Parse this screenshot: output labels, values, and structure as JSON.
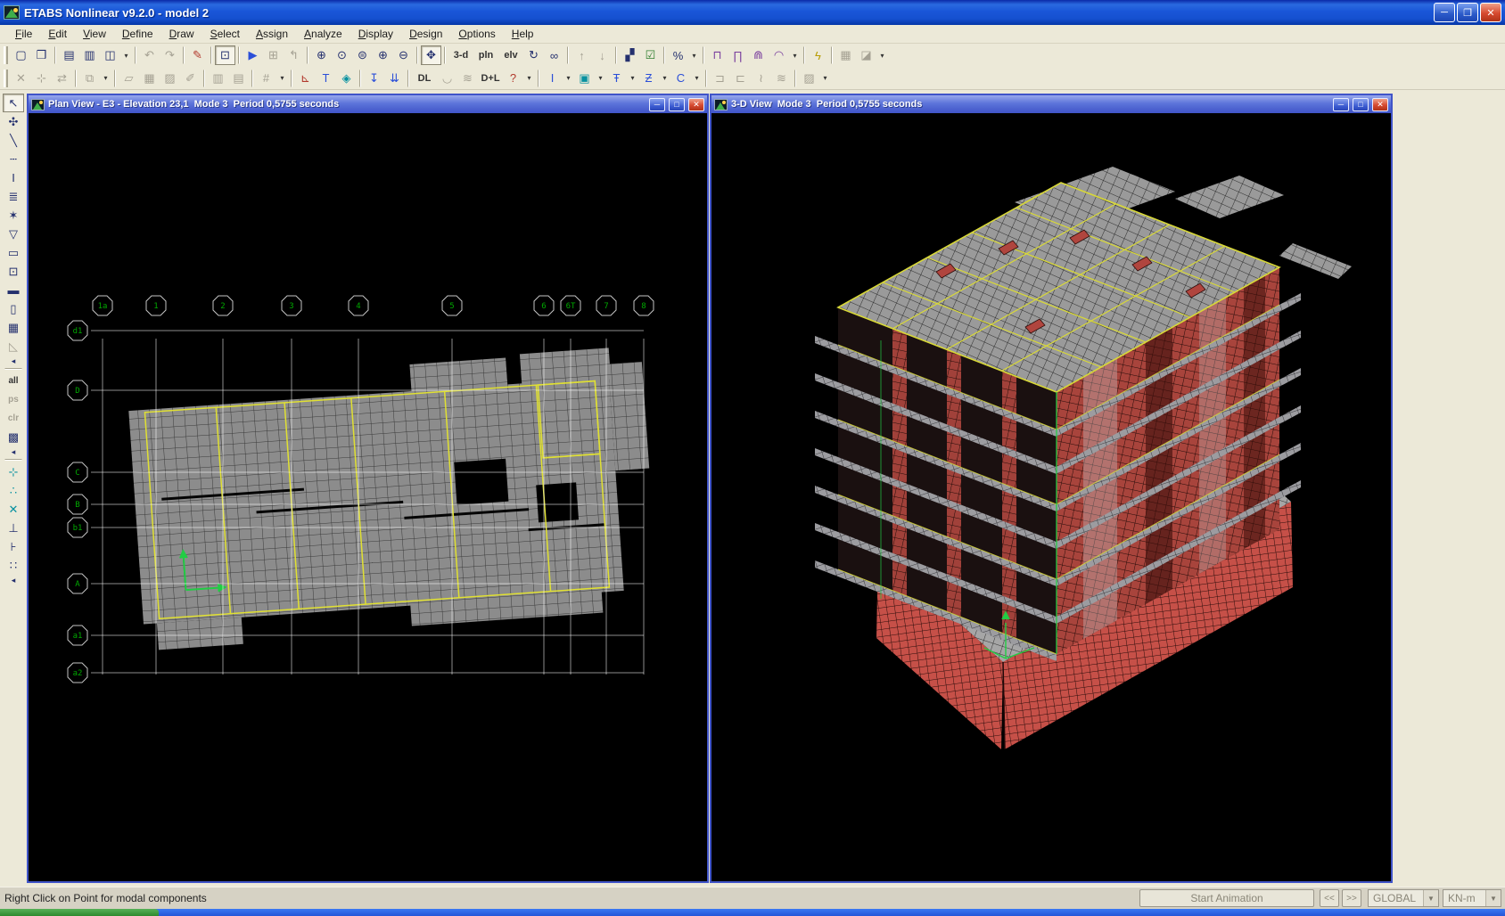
{
  "app": {
    "title": "ETABS Nonlinear v9.2.0 - model 2",
    "controls": [
      {
        "name": "app-minimize-button",
        "glyph": "─"
      },
      {
        "name": "app-restore-button",
        "glyph": "❐"
      },
      {
        "name": "app-close-button",
        "glyph": "✕",
        "cls": "close"
      }
    ]
  },
  "menu": {
    "items": [
      "File",
      "Edit",
      "View",
      "Define",
      "Draw",
      "Select",
      "Assign",
      "Analyze",
      "Display",
      "Design",
      "Options",
      "Help"
    ]
  },
  "toolbar_main": {
    "items": [
      {
        "name": "new-model-button",
        "glyph": "▢"
      },
      {
        "name": "open-file-button",
        "glyph": "❒"
      },
      {
        "name": "separator",
        "cls": "tsep"
      },
      {
        "name": "save-model-button",
        "glyph": "▤"
      },
      {
        "name": "print-button",
        "glyph": "▥"
      },
      {
        "name": "print-graphics-button",
        "glyph": "◫"
      },
      {
        "name": "print-options-caret",
        "glyph": "▾",
        "cls": "caret"
      },
      {
        "name": "separator",
        "cls": "tsep"
      },
      {
        "name": "undo-button",
        "glyph": "↶",
        "cls": "disabled"
      },
      {
        "name": "redo-button",
        "glyph": "↷",
        "cls": "disabled"
      },
      {
        "name": "separator",
        "cls": "tsep"
      },
      {
        "name": "edit-model-button",
        "glyph": "✎",
        "cls": "c-red"
      },
      {
        "name": "separator",
        "cls": "tsep"
      },
      {
        "name": "lock-model-button",
        "glyph": "⊡",
        "cls": "pressed"
      },
      {
        "name": "separator",
        "cls": "tsep"
      },
      {
        "name": "run-analysis-button",
        "glyph": "▶",
        "cls": "c-blue"
      },
      {
        "name": "run-construction-sequence-button",
        "glyph": "⊞",
        "cls": "disabled"
      },
      {
        "name": "restore-previous-button",
        "glyph": "↰",
        "cls": "disabled"
      },
      {
        "name": "separator",
        "cls": "tsep"
      },
      {
        "name": "rubber-band-zoom-button",
        "glyph": "⊕"
      },
      {
        "name": "restore-full-view-button",
        "glyph": "⊙"
      },
      {
        "name": "previous-zoom-button",
        "glyph": "⊜"
      },
      {
        "name": "zoom-in-button",
        "glyph": "⊕"
      },
      {
        "name": "zoom-out-button",
        "glyph": "⊖"
      },
      {
        "name": "separator",
        "cls": "tsep"
      },
      {
        "name": "pan-button",
        "glyph": "✥",
        "cls": "pressed"
      },
      {
        "name": "separator",
        "cls": "tsep"
      },
      {
        "name": "view-3d-button",
        "glyph": "3-d",
        "cls": "txt"
      },
      {
        "name": "view-plan-button",
        "glyph": "pln",
        "cls": "txt"
      },
      {
        "name": "view-elevation-button",
        "glyph": "elv",
        "cls": "txt"
      },
      {
        "name": "rotate-3d-view-button",
        "glyph": "↻"
      },
      {
        "name": "perspective-toggle-button",
        "glyph": "∞"
      },
      {
        "name": "separator",
        "cls": "tsep"
      },
      {
        "name": "move-up-in-list-button",
        "glyph": "↑",
        "cls": "disabled"
      },
      {
        "name": "move-down-in-list-button",
        "glyph": "↓",
        "cls": "disabled"
      },
      {
        "name": "separator",
        "cls": "tsep"
      },
      {
        "name": "object-shrink-toggle-button",
        "glyph": "▞"
      },
      {
        "name": "set-view-options-button",
        "glyph": "☑",
        "cls": "c-green"
      },
      {
        "name": "separator",
        "cls": "tsep"
      },
      {
        "name": "assign-display-button",
        "glyph": "%"
      },
      {
        "name": "assign-display-caret",
        "glyph": "▾",
        "cls": "caret"
      },
      {
        "name": "separator",
        "cls": "tsep"
      },
      {
        "name": "quick-draw-portal-button",
        "glyph": "⊓",
        "cls": "c-purple"
      },
      {
        "name": "quick-draw-frame-button",
        "glyph": "∏",
        "cls": "c-purple"
      },
      {
        "name": "quick-draw-braced-button",
        "glyph": "⋒",
        "cls": "c-purple"
      },
      {
        "name": "quick-draw-truss-button",
        "glyph": "◠",
        "cls": "c-purple"
      },
      {
        "name": "quick-draw-caret",
        "glyph": "▾",
        "cls": "caret"
      },
      {
        "name": "separator",
        "cls": "tsep"
      },
      {
        "name": "run-button",
        "glyph": "ϟ",
        "cls": "c-yellow"
      },
      {
        "name": "separator",
        "cls": "tsep"
      },
      {
        "name": "design-concrete-button",
        "glyph": "▦",
        "cls": "disabled"
      },
      {
        "name": "design-steel-button",
        "glyph": "◪",
        "cls": "disabled"
      },
      {
        "name": "design-caret",
        "glyph": "▾",
        "cls": "caret"
      }
    ]
  },
  "toolbar_second": {
    "items": [
      {
        "name": "delete-button",
        "glyph": "✕",
        "cls": "disabled"
      },
      {
        "name": "move-points-button",
        "glyph": "⊹",
        "cls": "disabled"
      },
      {
        "name": "mirror-button",
        "glyph": "⇄",
        "cls": "disabled"
      },
      {
        "name": "separator",
        "cls": "tsep"
      },
      {
        "name": "replicate-button",
        "glyph": "⧉",
        "cls": "disabled"
      },
      {
        "name": "replicate-caret",
        "glyph": "▾",
        "cls": "caret"
      },
      {
        "name": "separator",
        "cls": "tsep"
      },
      {
        "name": "mesh-areas-button",
        "glyph": "▱",
        "cls": "disabled"
      },
      {
        "name": "expand-areas-button",
        "glyph": "▦",
        "cls": "disabled"
      },
      {
        "name": "divide-areas-button",
        "glyph": "▨",
        "cls": "disabled"
      },
      {
        "name": "join-areas-button",
        "glyph": "✐",
        "cls": "disabled"
      },
      {
        "name": "separator",
        "cls": "tsep"
      },
      {
        "name": "partition-columns-button",
        "glyph": "▥",
        "cls": "disabled"
      },
      {
        "name": "partition-rows-button",
        "glyph": "▤",
        "cls": "disabled"
      },
      {
        "name": "separator",
        "cls": "tsep"
      },
      {
        "name": "waffle-options-button",
        "glyph": "#",
        "cls": "disabled"
      },
      {
        "name": "waffle-caret",
        "glyph": "▾",
        "cls": "caret"
      },
      {
        "name": "separator",
        "cls": "tsep"
      },
      {
        "name": "show-axes-button",
        "glyph": "⊾",
        "cls": "c-red"
      },
      {
        "name": "show-labels-button",
        "glyph": "T",
        "cls": "c-blue"
      },
      {
        "name": "show-plane-button",
        "glyph": "◈",
        "cls": "c-cyan"
      },
      {
        "name": "separator",
        "cls": "tsep"
      },
      {
        "name": "show-point-loads-button",
        "glyph": "↧",
        "cls": "c-blue"
      },
      {
        "name": "show-distributed-loads-button",
        "glyph": "⇊",
        "cls": "c-blue"
      },
      {
        "name": "separator",
        "cls": "tsep"
      },
      {
        "name": "show-dead-load-button",
        "glyph": "DL",
        "cls": "txt"
      },
      {
        "name": "show-moment-diagram-button",
        "glyph": "◡",
        "cls": "disabled"
      },
      {
        "name": "show-response-button",
        "glyph": "≋",
        "cls": "disabled"
      },
      {
        "name": "show-combo-load-button",
        "glyph": "D+L",
        "cls": "txt"
      },
      {
        "name": "show-query-button",
        "glyph": "?",
        "cls": "c-red"
      },
      {
        "name": "query-caret",
        "glyph": "▾",
        "cls": "caret"
      },
      {
        "name": "separator",
        "cls": "tsep"
      },
      {
        "name": "frame-section-button",
        "glyph": "I",
        "cls": "c-blue"
      },
      {
        "name": "frame-section-caret",
        "glyph": "▾",
        "cls": "caret"
      },
      {
        "name": "slab-section-button",
        "glyph": "▣",
        "cls": "c-cyan"
      },
      {
        "name": "slab-section-caret",
        "glyph": "▾",
        "cls": "caret"
      },
      {
        "name": "tee-section-button",
        "glyph": "Ŧ",
        "cls": "c-blue"
      },
      {
        "name": "tee-section-caret",
        "glyph": "▾",
        "cls": "caret"
      },
      {
        "name": "zee-section-button",
        "glyph": "Ƶ",
        "cls": "c-blue"
      },
      {
        "name": "zee-section-caret",
        "glyph": "▾",
        "cls": "caret"
      },
      {
        "name": "channel-section-button",
        "glyph": "C",
        "cls": "c-blue"
      },
      {
        "name": "channel-section-caret",
        "glyph": "▾",
        "cls": "caret"
      },
      {
        "name": "separator",
        "cls": "tsep"
      },
      {
        "name": "link-props-button",
        "glyph": "⊐",
        "cls": "disabled"
      },
      {
        "name": "spring-props-button",
        "glyph": "⊏",
        "cls": "disabled"
      },
      {
        "name": "damper-props-button",
        "glyph": "≀",
        "cls": "disabled"
      },
      {
        "name": "isolator-props-button",
        "glyph": "≋",
        "cls": "disabled"
      },
      {
        "name": "separator",
        "cls": "tsep"
      },
      {
        "name": "material-props-button",
        "glyph": "▨",
        "cls": "disabled"
      },
      {
        "name": "material-caret",
        "glyph": "▾",
        "cls": "caret"
      }
    ]
  },
  "toolbar_side": {
    "items": [
      {
        "name": "select-pointer-button",
        "glyph": "↖",
        "cls": "pressed"
      },
      {
        "name": "reshape-object-button",
        "glyph": "✣"
      },
      {
        "name": "draw-line-button",
        "glyph": "╲"
      },
      {
        "name": "draw-frame-button",
        "glyph": "┄"
      },
      {
        "name": "quick-draw-frame-button",
        "glyph": "I"
      },
      {
        "name": "quick-draw-secondary-beams-button",
        "glyph": "≣"
      },
      {
        "name": "draw-braces-button",
        "glyph": "✶"
      },
      {
        "name": "draw-area-button",
        "glyph": "▽"
      },
      {
        "name": "draw-rect-area-button",
        "glyph": "▭"
      },
      {
        "name": "quick-draw-area-button",
        "glyph": "⊡"
      },
      {
        "name": "draw-wall-button",
        "glyph": "▬"
      },
      {
        "name": "quick-draw-wall-button",
        "glyph": "▯"
      },
      {
        "name": "draw-mesh-button",
        "glyph": "▦"
      },
      {
        "name": "draw-ramp-button",
        "glyph": "◺",
        "cls": "disabled"
      },
      {
        "name": "collapse-draw-arrow",
        "glyph": "◂",
        "cls": "small"
      },
      {
        "name": "separator",
        "cls": "sep-h"
      },
      {
        "name": "select-all-button",
        "glyph": "all",
        "cls": "txt"
      },
      {
        "name": "previous-selection-button",
        "glyph": "ps",
        "cls": "txt disabled"
      },
      {
        "name": "clear-selection-button",
        "glyph": "clr",
        "cls": "txt disabled"
      },
      {
        "name": "select-by-groups-button",
        "glyph": "▩"
      },
      {
        "name": "collapse-select-arrow",
        "glyph": "◂",
        "cls": "small"
      },
      {
        "name": "separator",
        "cls": "sep-h"
      },
      {
        "name": "snap-points-button",
        "glyph": "⊹",
        "cls": "c-cyan"
      },
      {
        "name": "snap-midpoints-button",
        "glyph": "∴",
        "cls": "c-cyan"
      },
      {
        "name": "snap-intersections-button",
        "glyph": "✕",
        "cls": "c-cyan"
      },
      {
        "name": "snap-perpendicular-button",
        "glyph": "⊥"
      },
      {
        "name": "snap-lines-edges-button",
        "glyph": "⊦"
      },
      {
        "name": "snap-fine-grid-button",
        "glyph": "∷"
      },
      {
        "name": "collapse-snap-arrow",
        "glyph": "◂",
        "cls": "small"
      }
    ]
  },
  "plan_window": {
    "title": "Plan View - E3 - Elevation 23,1  Mode 3  Period 0,5755 seconds",
    "controls": [
      {
        "name": "plan-minimize-button",
        "glyph": "─"
      },
      {
        "name": "plan-maximize-button",
        "glyph": "□"
      },
      {
        "name": "plan-close-button",
        "glyph": "✕",
        "cls": "close"
      }
    ],
    "grid_cols": [
      "1a",
      "1",
      "2",
      "3",
      "4",
      "5",
      "6",
      "6T",
      "7",
      "8"
    ],
    "grid_rows": [
      "d1",
      "D",
      "C",
      "B",
      "b1",
      "A",
      "a1",
      "a2"
    ]
  },
  "view3d_window": {
    "title": "3-D View  Mode 3  Period 0,5755 seconds",
    "controls": [
      {
        "name": "v3d-minimize-button",
        "glyph": "─"
      },
      {
        "name": "v3d-maximize-button",
        "glyph": "□"
      },
      {
        "name": "v3d-close-button",
        "glyph": "✕",
        "cls": "close"
      }
    ]
  },
  "status": {
    "hint": "Right Click on Point for modal components",
    "animation_button": "Start Animation",
    "prev_button": "<<",
    "next_button": ">>",
    "coord_system": "GLOBAL",
    "units": "KN-m"
  },
  "colors": {
    "slab_mesh": "#8c8c8c",
    "beam_outline": "#e0e032",
    "wall_red": "#a8443c",
    "podium_red": "#c65048",
    "axis_green": "#22cc44",
    "grid_label_green": "#00a800"
  }
}
